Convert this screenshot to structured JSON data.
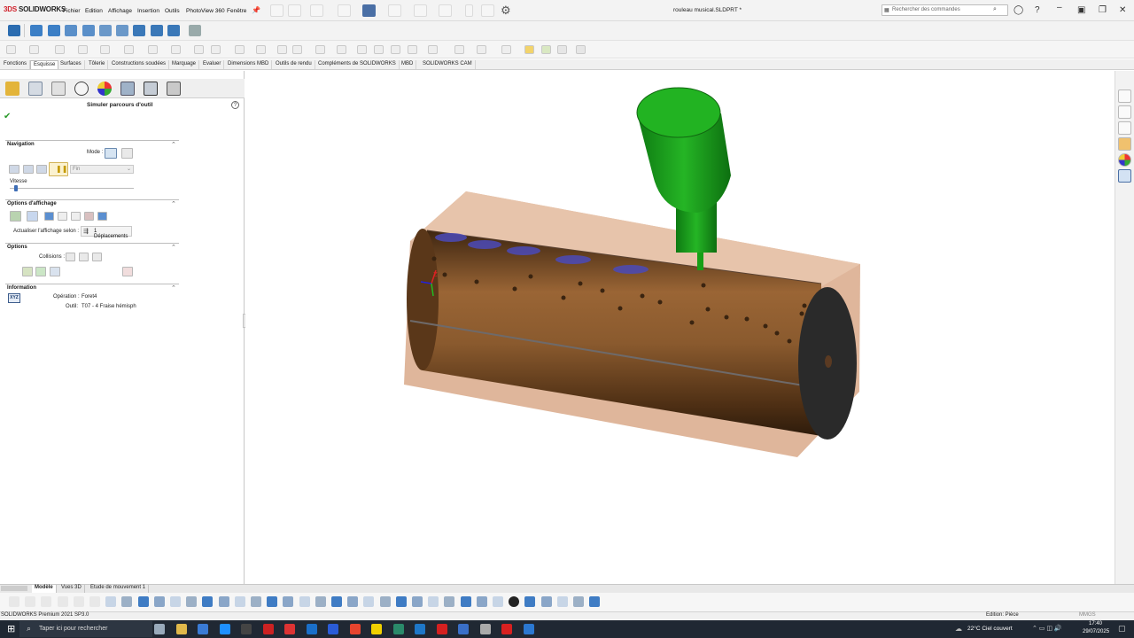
{
  "app": {
    "logo_prefix": "3DS ",
    "logo_main": "SOLIDWORKS"
  },
  "menu": [
    "Fichier",
    "Edition",
    "Affichage",
    "Insertion",
    "Outils",
    "PhotoView 360",
    "Fenêtre"
  ],
  "document_title": "rouleau musical.SLDPRT *",
  "search": {
    "placeholder": "Rechercher des commandes"
  },
  "tabs": [
    "Fonctions",
    "Esquisse",
    "Surfaces",
    "Tôlerie",
    "Constructions soudées",
    "Marquage",
    "Evaluer",
    "Dimensions MBD",
    "Outils de rendu",
    "Compléments de SOLIDWORKS",
    "MBD",
    "SOLIDWORKS CAM"
  ],
  "active_tab": "Esquisse",
  "property_manager": {
    "title": "Simuler parcours d'outil",
    "navigation": {
      "header": "Navigation",
      "mode_label": "Mode :",
      "step_select": "Fin",
      "speed_label": "Vitesse",
      "speed_value": 0.05
    },
    "display_options": {
      "header": "Options d'affichage",
      "update_label": "Actualiser l'affichage selon :",
      "update_value": "1 Déplacements"
    },
    "options": {
      "header": "Options",
      "collisions_label": "Collisions :"
    },
    "information": {
      "header": "Information",
      "xyz_label": "XYZ",
      "operation_label": "Opération :",
      "operation_value": "Foret4",
      "tool_label": "Outil:",
      "tool_value": "T07 - 4 Fraise hémisph"
    }
  },
  "bottom_tabs": [
    "Modèle",
    "Vues 3D",
    "Etude de mouvement 1"
  ],
  "active_bottom_tab": "Modèle",
  "status": {
    "version": "SOLIDWORKS Premium 2021 SP3.0",
    "edit_mode": "Edition: Pièce",
    "units": "MMGS"
  },
  "taskbar": {
    "search_placeholder": "Taper ici pour rechercher",
    "weather": "22°C  Ciel couvert",
    "time": "17:40",
    "date": "29/07/2025"
  },
  "colors": {
    "stock": "#d9a98a",
    "part": "#7b4a25",
    "tool_head": "#1fb31f",
    "tool_shank": "#17a017",
    "cuts": "#4b4ab8",
    "accent_red": "#d0202a"
  }
}
